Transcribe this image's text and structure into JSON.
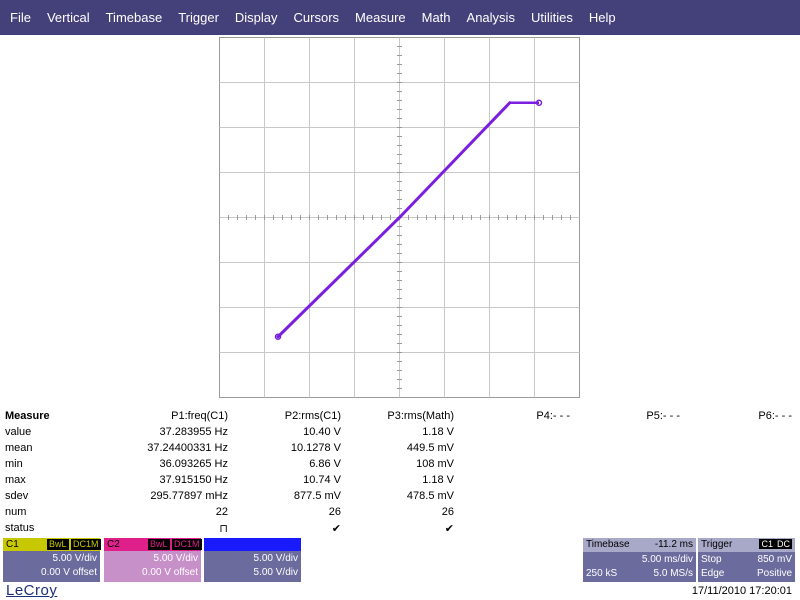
{
  "menu": [
    "File",
    "Vertical",
    "Timebase",
    "Trigger",
    "Display",
    "Cursors",
    "Measure",
    "Math",
    "Analysis",
    "Utilities",
    "Help"
  ],
  "colors": {
    "menubar": "#44407a",
    "trace": "#7a1fe0",
    "c1": "#c8c800",
    "c2": "#e0208a",
    "c3": "#1a1aff",
    "panel": "#6b6b9d"
  },
  "trace": {
    "points": [
      [
        -2.7,
        -2.65
      ],
      [
        0,
        0
      ],
      [
        2.45,
        2.55
      ]
    ],
    "flat_segment": [
      [
        2.45,
        2.55
      ],
      [
        3.1,
        2.55
      ]
    ]
  },
  "measure": {
    "title": "Measure",
    "columns": [
      "P1:freq(C1)",
      "P2:rms(C1)",
      "P3:rms(Math)",
      "P4:- - -",
      "P5:- - -",
      "P6:- - -"
    ],
    "rows": [
      {
        "label": "value",
        "p1": "37.283955 Hz",
        "p2": "10.40 V",
        "p3": "1.18 V"
      },
      {
        "label": "mean",
        "p1": "37.24400331 Hz",
        "p2": "10.1278 V",
        "p3": "449.5 mV"
      },
      {
        "label": "min",
        "p1": "36.093265 Hz",
        "p2": "6.86 V",
        "p3": "108 mV"
      },
      {
        "label": "max",
        "p1": "37.915150 Hz",
        "p2": "10.74 V",
        "p3": "1.18 V"
      },
      {
        "label": "sdev",
        "p1": "295.77897 mHz",
        "p2": "877.5 mV",
        "p3": "478.5 mV"
      },
      {
        "label": "num",
        "p1": "22",
        "p2": "26",
        "p3": "26"
      },
      {
        "label": "status",
        "p1": "⊓",
        "p2": "✔",
        "p3": "✔"
      }
    ]
  },
  "channels": {
    "c1": {
      "name": "C1",
      "tag1": "BwL",
      "tag2": "DC1M",
      "vdiv": "5.00 V/div",
      "offset": "0.00 V offset"
    },
    "c2": {
      "name": "C2",
      "tag1": "BwL",
      "tag2": "DC1M",
      "vdiv": "5.00 V/div",
      "offset": "0.00 V offset"
    },
    "c3": {
      "vdiv": "5.00 V/div",
      "offset": "5.00 V/div"
    }
  },
  "timebase": {
    "label": "Timebase",
    "delay": "-11.2 ms",
    "tdiv": "5.00 ms/div",
    "samples": "250 kS",
    "rate": "5.0 MS/s"
  },
  "trigger": {
    "label": "Trigger",
    "source": "C1",
    "coupling": "DC",
    "mode": "Stop",
    "level": "850 mV",
    "type": "Edge",
    "slope": "Positive"
  },
  "brand": "LeCroy",
  "datetime": "17/11/2010 17:20:01"
}
